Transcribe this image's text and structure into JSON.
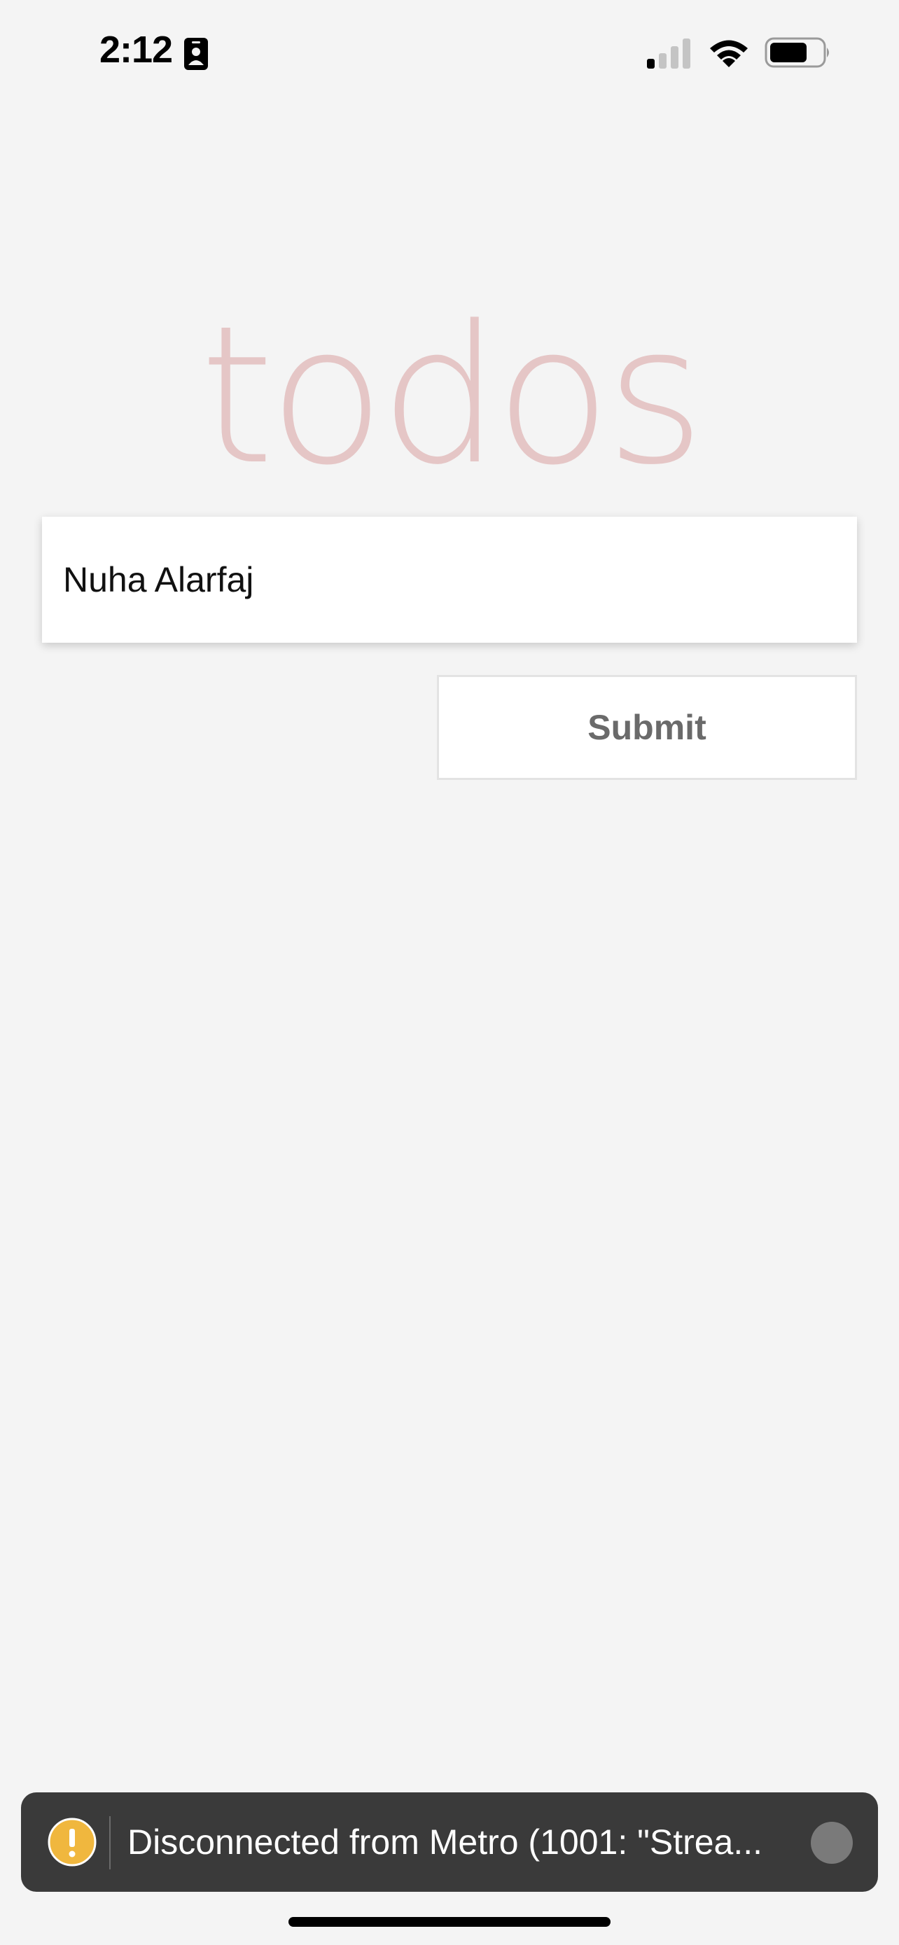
{
  "status_bar": {
    "time": "2:12",
    "icons": [
      "id-badge-icon",
      "cellular-signal-icon",
      "wifi-icon",
      "battery-icon"
    ]
  },
  "app": {
    "title": "todos",
    "title_color": "#e5c6c6",
    "background_color": "#f4f4f4"
  },
  "todo_input": {
    "value": "Nuha Alarfaj"
  },
  "submit_button": {
    "label": "Submit"
  },
  "toast": {
    "icon": "warning-icon",
    "icon_color": "#f0b73e",
    "message": "Disconnected from Metro (1001: \"Strea...",
    "background_color": "#3a3a3a"
  }
}
